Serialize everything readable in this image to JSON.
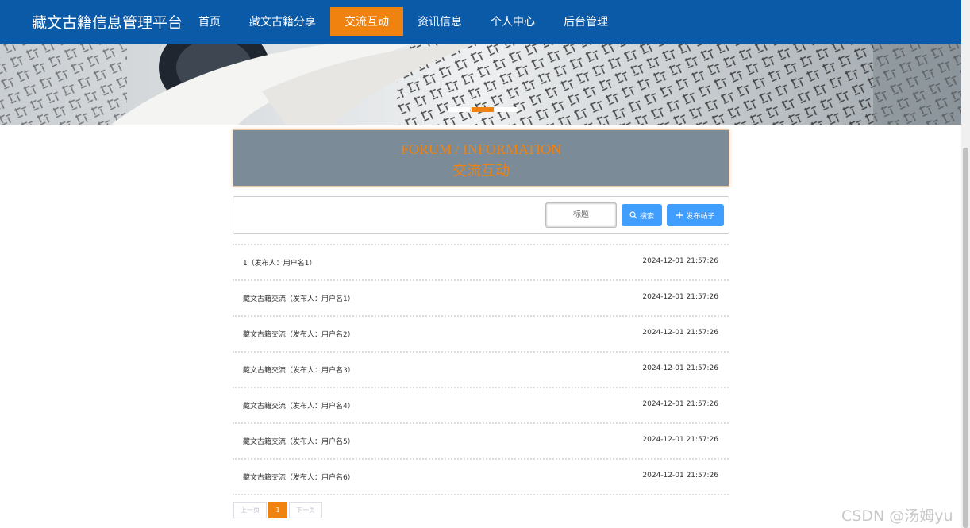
{
  "header": {
    "brand": "藏文古籍信息管理平台",
    "nav": [
      {
        "label": "首页"
      },
      {
        "label": "藏文古籍分享"
      },
      {
        "label": "交流互动",
        "active": true
      },
      {
        "label": "资讯信息"
      },
      {
        "label": "个人中心"
      },
      {
        "label": "后台管理"
      }
    ],
    "nav_color": "#0a5aa8",
    "accent_color": "#f08210"
  },
  "banner": {
    "slides": 3,
    "active_slide": 2
  },
  "section": {
    "title_en": "FORUM / INFORMATION",
    "title_cn": "交流互动"
  },
  "search": {
    "placeholder": "标题",
    "search_button": "搜索",
    "post_button": "发布帖子",
    "search_icon": "search-icon",
    "post_icon": "plus-icon"
  },
  "posts": [
    {
      "title": "1（发布人：用户名1）",
      "time": "2024-12-01 21:57:26"
    },
    {
      "title": "藏文古籍交流（发布人：用户名1）",
      "time": "2024-12-01 21:57:26"
    },
    {
      "title": "藏文古籍交流（发布人：用户名2）",
      "time": "2024-12-01 21:57:26"
    },
    {
      "title": "藏文古籍交流（发布人：用户名3）",
      "time": "2024-12-01 21:57:26"
    },
    {
      "title": "藏文古籍交流（发布人：用户名4）",
      "time": "2024-12-01 21:57:26"
    },
    {
      "title": "藏文古籍交流（发布人：用户名5）",
      "time": "2024-12-01 21:57:26"
    },
    {
      "title": "藏文古籍交流（发布人：用户名6）",
      "time": "2024-12-01 21:57:26"
    }
  ],
  "pagination": {
    "prev": "上一页",
    "current": "1",
    "next": "下一页"
  },
  "watermark": "CSDN @汤姆yu"
}
